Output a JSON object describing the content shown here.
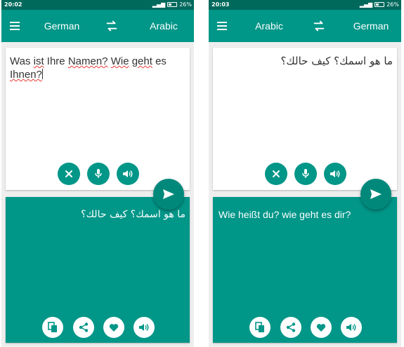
{
  "colors": {
    "primary": "#009688",
    "primary_dark": "#00695c",
    "accent": "#00897b",
    "surface": "#ffffff",
    "error_underline": "#e53935"
  },
  "screens": [
    {
      "status": {
        "time": "20:02",
        "battery": "26%"
      },
      "toolbar": {
        "menu_icon": "menu-icon",
        "from_lang": "German",
        "swap_icon": "swap-icon",
        "to_lang": "Arabic"
      },
      "input": {
        "words": [
          {
            "text": "Was",
            "misspelled": false
          },
          {
            "text": "ist",
            "misspelled": true
          },
          {
            "text": "Ihre",
            "misspelled": false
          },
          {
            "text": "Namen?",
            "misspelled": true
          },
          {
            "text": "Wie",
            "misspelled": true
          },
          {
            "text": "geht",
            "misspelled": true
          },
          {
            "text": "es",
            "misspelled": false
          },
          {
            "text": "Ihnen?",
            "misspelled": true
          }
        ],
        "direction": "ltr",
        "buttons": [
          "clear-icon",
          "microphone-icon",
          "speaker-icon"
        ]
      },
      "send_icon": "send-icon",
      "output": {
        "text": "ما هو اسمك؟ كيف حالك؟",
        "direction": "rtl",
        "buttons": [
          "copy-icon",
          "share-icon",
          "heart-icon",
          "speaker-icon"
        ]
      }
    },
    {
      "status": {
        "time": "20:03",
        "battery": "26%"
      },
      "toolbar": {
        "menu_icon": "menu-icon",
        "from_lang": "Arabic",
        "swap_icon": "swap-icon",
        "to_lang": "German"
      },
      "input": {
        "text": "ما هو اسمك؟ كيف حالك؟",
        "direction": "rtl",
        "buttons": [
          "clear-icon",
          "microphone-icon",
          "speaker-icon"
        ]
      },
      "send_icon": "send-icon",
      "output": {
        "text": "Wie heißt du? wie geht es dir?",
        "direction": "ltr",
        "buttons": [
          "copy-icon",
          "share-icon",
          "heart-icon",
          "speaker-icon"
        ]
      }
    }
  ]
}
